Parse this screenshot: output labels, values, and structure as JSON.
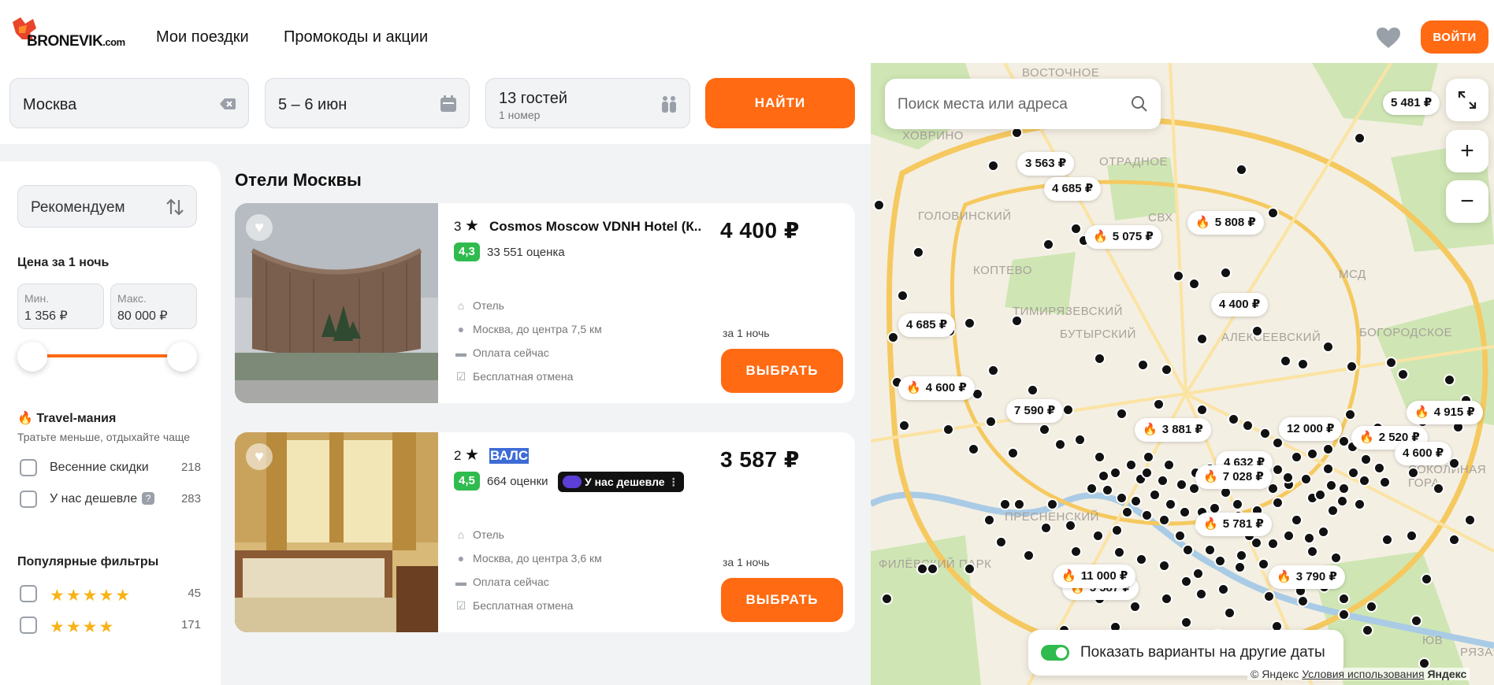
{
  "header": {
    "logo_text": "BRONEVIK",
    "logo_suffix": ".com",
    "nav": [
      "Мои поездки",
      "Промокоды и акции"
    ],
    "login_label": "ВОЙТИ"
  },
  "search": {
    "city": "Москва",
    "dates": "5 – 6 июн",
    "guests": "13 гостей",
    "rooms": "1 номер",
    "find_label": "НАЙТИ"
  },
  "sidebar": {
    "sort": "Рекомендуем",
    "price_title": "Цена за 1 ночь",
    "min_label": "Мин.",
    "min_value": "1 356 ₽",
    "max_label": "Макс.",
    "max_value": "80 000 ₽",
    "slider_min_fraction": 0.0,
    "slider_max_fraction": 1.0,
    "travel_title": "Travel-мания",
    "travel_sub": "Тратьте меньше, отдыхайте чаще",
    "travel_filters": [
      {
        "label": "Весенние скидки",
        "count": "218"
      },
      {
        "label": "У нас дешевле",
        "count": "283"
      }
    ],
    "popular_title": "Популярные фильтры",
    "star_filters": [
      {
        "stars": "★★★★★",
        "count": "45"
      },
      {
        "stars": "★★★★",
        "count": "171"
      }
    ]
  },
  "listing": {
    "title": "Отели Москвы",
    "hotels": [
      {
        "stars": "3",
        "name": "Cosmos Moscow VDNH Hotel (К...",
        "rating": "4,3",
        "reviews": "33 551 оценка",
        "type": "Отель",
        "location": "Москва, до центра 7,5 км",
        "payment": "Оплата сейчас",
        "cancel": "Бесплатная отмена",
        "price": "4 400 ₽",
        "per_night": "за 1 ночь",
        "cta": "ВЫБРАТЬ"
      },
      {
        "stars": "2",
        "name": "ВАЛС",
        "rating": "4,5",
        "reviews": "664 оценки",
        "badge": "У нас дешевле",
        "type": "Отель",
        "location": "Москва, до центра 3,6 км",
        "payment": "Оплата сейчас",
        "cancel": "Бесплатная отмена",
        "price": "3 587 ₽",
        "per_night": "за 1 ночь",
        "cta": "ВЫБРАТЬ"
      }
    ]
  },
  "map": {
    "search_placeholder": "Поиск места или адреса",
    "toggle_label": "Показать варианты на другие даты",
    "copyright_prefix": "© Яндекс",
    "terms_link": "Условия использования",
    "provider": "Яндекс",
    "districts": [
      "ВОСТОЧНОЕ",
      "ХОВРИНО",
      "ОТРАДНОЕ",
      "ГОЛОВИНСКИЙ",
      "КОПТЕВО",
      "ТИМИРЯЗЕВСКИЙ",
      "БУТЫРСКИЙ",
      "АЛЕКСЕЕВСКИЙ",
      "БОГОРОДСКОЕ",
      "СОКОЛИНАЯ ГОРА",
      "ФИЛЁВСКИЙ ПАРК",
      "ПРЕСНЕНСКИЙ",
      "ЮВ",
      "РЯЗАНС",
      "СВХ",
      "МСД"
    ],
    "pins": [
      {
        "label": "5 481 ₽",
        "hot": false
      },
      {
        "label": "3 563 ₽",
        "hot": false
      },
      {
        "label": "4 685 ₽",
        "hot": false
      },
      {
        "label": "5 075 ₽",
        "hot": true
      },
      {
        "label": "5 808 ₽",
        "hot": true
      },
      {
        "label": "4 400 ₽",
        "hot": false
      },
      {
        "label": "4 685 ₽",
        "hot": false
      },
      {
        "label": "4 600 ₽",
        "hot": true
      },
      {
        "label": "7 590 ₽",
        "hot": false
      },
      {
        "label": "3 881 ₽",
        "hot": true
      },
      {
        "label": "12 000 ₽",
        "hot": false
      },
      {
        "label": "2 520 ₽",
        "hot": true
      },
      {
        "label": "4 915 ₽",
        "hot": true
      },
      {
        "label": "4 600 ₽",
        "hot": false
      },
      {
        "label": "4 632 ₽",
        "hot": false
      },
      {
        "label": "7 028 ₽",
        "hot": true
      },
      {
        "label": "5 781 ₽",
        "hot": true
      },
      {
        "label": "11 000 ₽",
        "hot": true
      },
      {
        "label": "3 790 ₽",
        "hot": true
      },
      {
        "label": "5 587 ₽",
        "hot": true
      }
    ]
  }
}
